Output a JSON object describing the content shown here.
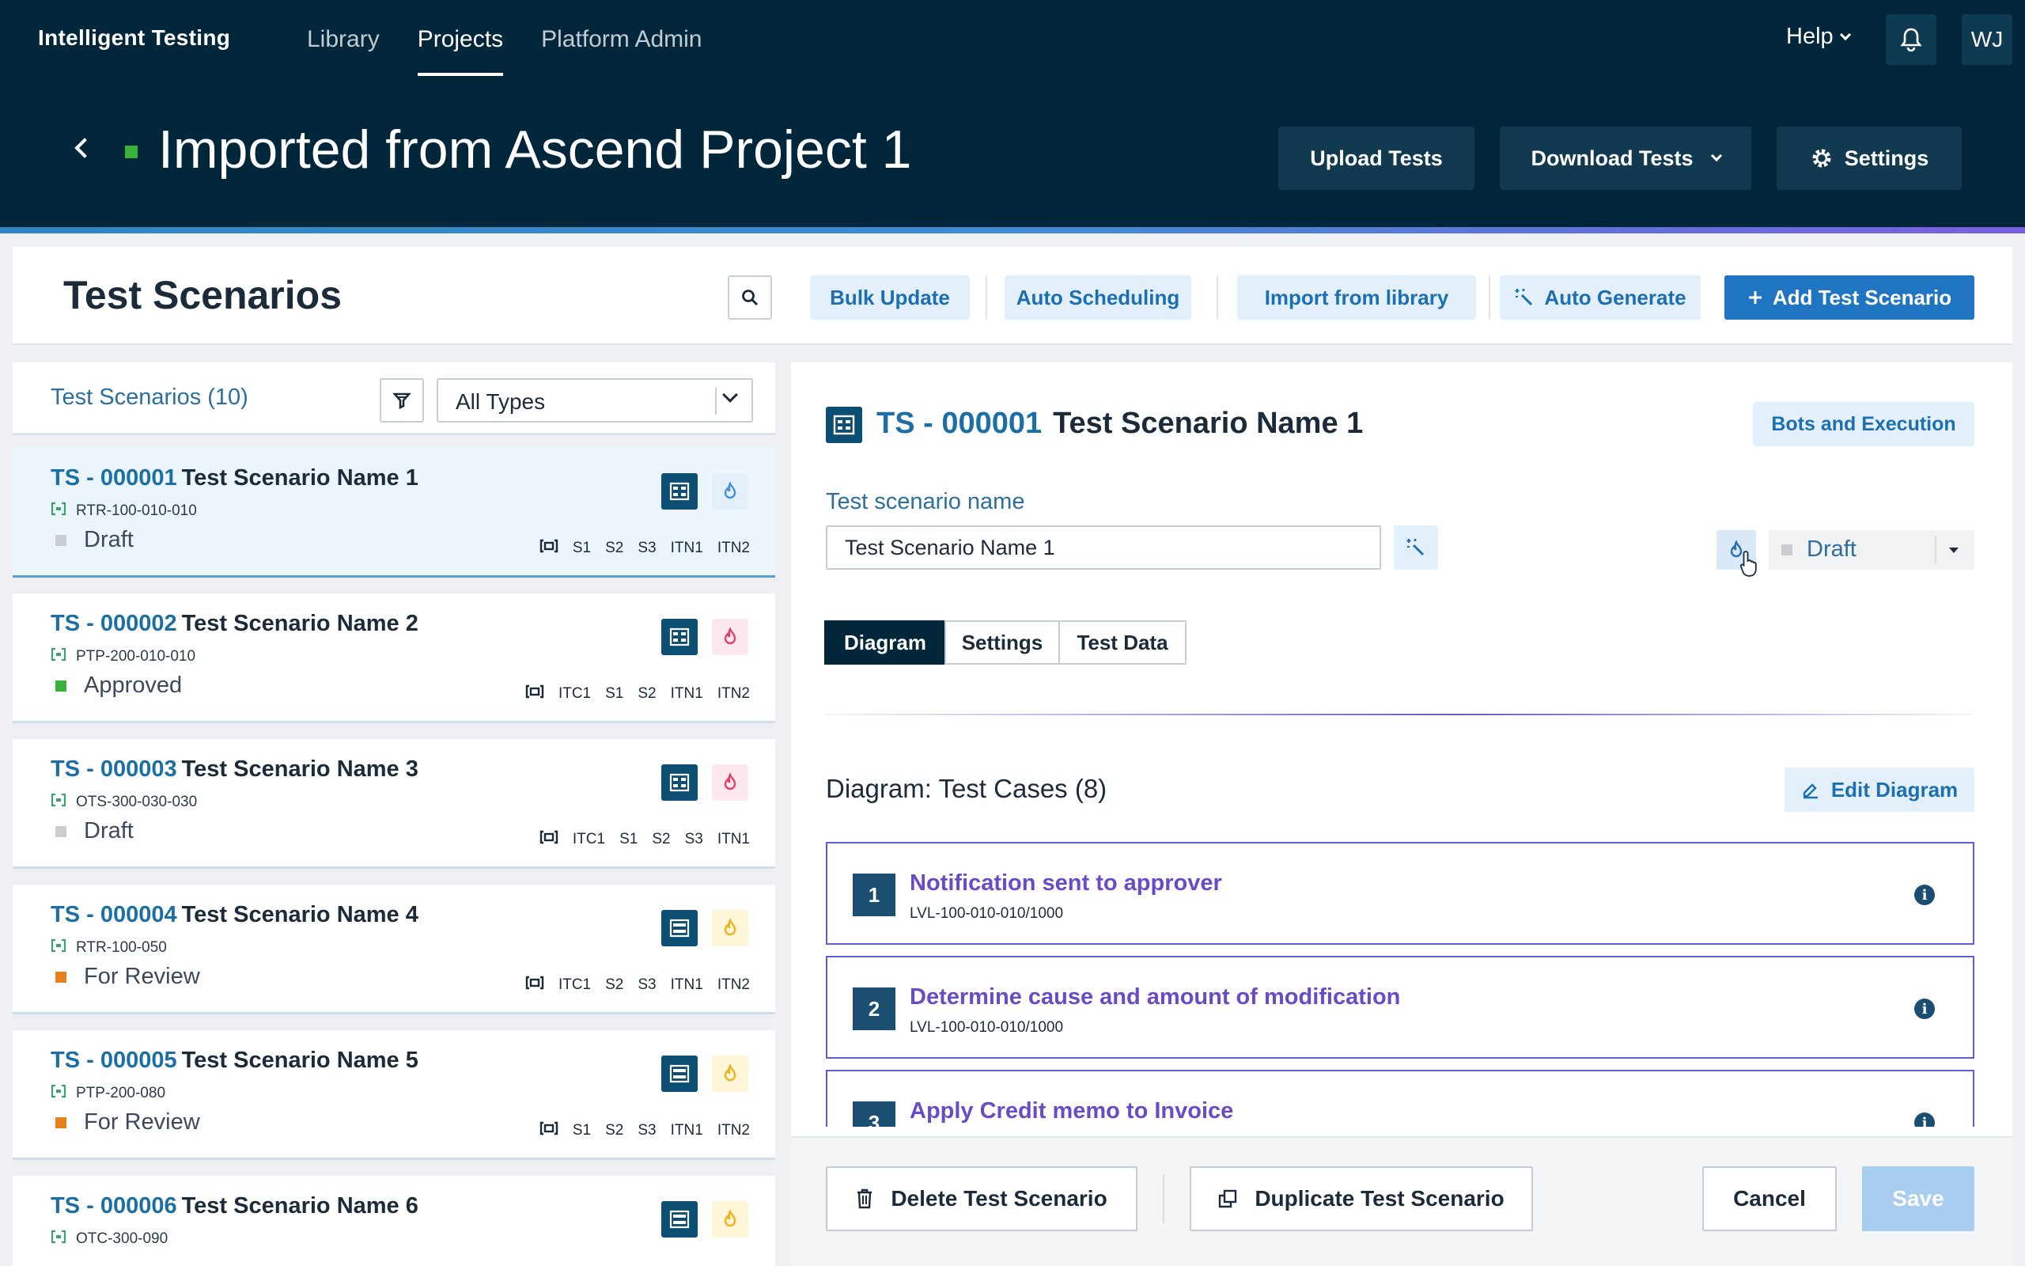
{
  "topnav": {
    "brand": "Intelligent Testing",
    "items": [
      "Library",
      "Projects",
      "Platform Admin"
    ],
    "active": "Projects",
    "help": "Help",
    "user_initials": "WJ"
  },
  "project": {
    "title": "Imported from Ascend Project 1",
    "status_color": "#38b23a",
    "buttons": {
      "upload": "Upload Tests",
      "download": "Download Tests",
      "settings": "Settings"
    }
  },
  "toolbar": {
    "heading": "Test Scenarios",
    "bulk_update": "Bulk Update",
    "auto_scheduling": "Auto Scheduling",
    "import_library": "Import from library",
    "auto_generate": "Auto Generate",
    "add_scenario": "Add Test Scenario"
  },
  "list": {
    "count_label": "Test Scenarios (10)",
    "type_filter": "All Types",
    "items": [
      {
        "id": "TS - 000001",
        "name": "Test Scenario Name 1",
        "code": "RTR-100-010-010",
        "status": "Draft",
        "status_color": "#c9ccd0",
        "flame_color": "#4a90d9",
        "flame_bg": "#e3f0fb",
        "tags": [
          "S1",
          "S2",
          "S3",
          "ITN1",
          "ITN2"
        ]
      },
      {
        "id": "TS - 000002",
        "name": "Test Scenario Name 2",
        "code": "PTP-200-010-010",
        "status": "Approved",
        "status_color": "#38b23a",
        "flame_color": "#e0406a",
        "flame_bg": "#fde8ee",
        "tags": [
          "ITC1",
          "S1",
          "S2",
          "ITN1",
          "ITN2"
        ]
      },
      {
        "id": "TS - 000003",
        "name": "Test Scenario Name 3",
        "code": "OTS-300-030-030",
        "status": "Draft",
        "status_color": "#c9ccd0",
        "flame_color": "#e0406a",
        "flame_bg": "#fde8ee",
        "tags": [
          "ITC1",
          "S1",
          "S2",
          "S3",
          "ITN1"
        ]
      },
      {
        "id": "TS - 000004",
        "name": "Test Scenario Name 4",
        "code": "RTR-100-050",
        "status": "For Review",
        "status_color": "#e8801f",
        "flame_color": "#f2b21b",
        "flame_bg": "#fff5d9",
        "tags": [
          "ITC1",
          "S2",
          "S3",
          "ITN1",
          "ITN2"
        ]
      },
      {
        "id": "TS - 000005",
        "name": "Test Scenario Name 5",
        "code": "PTP-200-080",
        "status": "For Review",
        "status_color": "#e8801f",
        "flame_color": "#f2b21b",
        "flame_bg": "#fff5d9",
        "tags": [
          "S1",
          "S2",
          "S3",
          "ITN1",
          "ITN2"
        ]
      },
      {
        "id": "TS - 000006",
        "name": "Test Scenario Name 6",
        "code": "OTC-300-090",
        "status": "",
        "status_color": "#c9ccd0",
        "flame_color": "#f2b21b",
        "flame_bg": "#fff5d9",
        "tags": []
      }
    ]
  },
  "detail": {
    "id": "TS - 000001",
    "name": "Test Scenario Name 1",
    "bots_button": "Bots and Execution",
    "name_label": "Test scenario name",
    "name_value": "Test Scenario Name 1",
    "status": "Draft",
    "tabs": [
      "Diagram",
      "Settings",
      "Test Data"
    ],
    "active_tab": "Diagram",
    "diagram_heading": "Diagram: Test Cases (8)",
    "edit_diagram": "Edit Diagram",
    "test_cases": [
      {
        "num": "1",
        "title": "Notification sent to approver",
        "code": "LVL-100-010-010/1000"
      },
      {
        "num": "2",
        "title": "Determine cause and amount of modification",
        "code": "LVL-100-010-010/1000"
      },
      {
        "num": "3",
        "title": "Apply Credit memo to Invoice",
        "code": ""
      }
    ],
    "footer": {
      "delete": "Delete Test Scenario",
      "duplicate": "Duplicate Test Scenario",
      "cancel": "Cancel",
      "save": "Save"
    }
  }
}
